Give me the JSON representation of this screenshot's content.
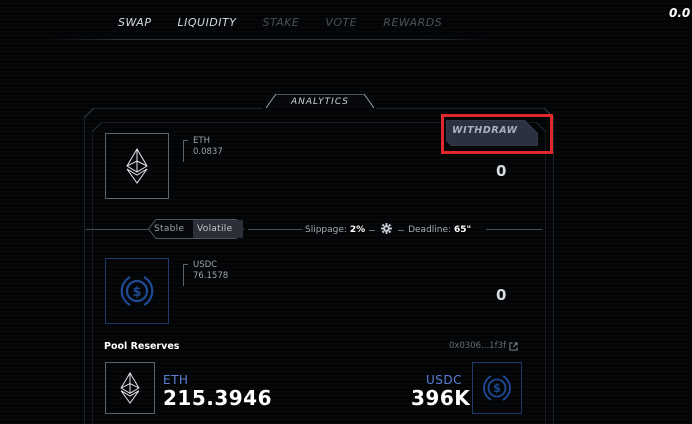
{
  "nav": {
    "items": [
      {
        "label": "SWAP",
        "active": true
      },
      {
        "label": "LIQUIDITY",
        "active": true
      },
      {
        "label": "STAKE",
        "active": false
      },
      {
        "label": "VOTE",
        "active": false
      },
      {
        "label": "REWARDS",
        "active": false
      }
    ],
    "top_right_value": "0.0"
  },
  "panel": {
    "tab_label": "ANALYTICS",
    "withdraw_label": "WITHDRAW",
    "token_a": {
      "symbol": "ETH",
      "balance": "0.0837",
      "amount": "0",
      "icon": "ethereum-icon"
    },
    "token_b": {
      "symbol": "USDC",
      "balance": "76.1578",
      "amount": "0",
      "icon": "usdc-icon"
    },
    "pool_type": {
      "options": [
        "Stable",
        "Volatile"
      ],
      "selected": "Volatile"
    },
    "settings": {
      "slippage_label": "Slippage:",
      "slippage_value": "2%",
      "deadline_label": "Deadline:",
      "deadline_value": "65\""
    }
  },
  "pool_reserves": {
    "title": "Pool Reserves",
    "address": "0x0306...1f3f",
    "token_a": {
      "symbol": "ETH",
      "value": "215.3946"
    },
    "token_b": {
      "symbol": "USDC",
      "value": "396K"
    }
  },
  "colors": {
    "background": "#030406",
    "accent_blue": "#5d7fd6",
    "usdc_blue": "#1d3a6b",
    "highlight_red": "#e0272b"
  }
}
